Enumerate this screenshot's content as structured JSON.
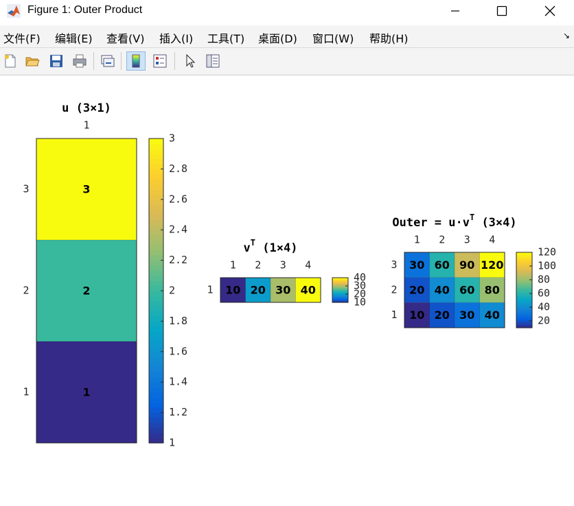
{
  "window": {
    "title": "Figure 1: Outer Product"
  },
  "menu": {
    "items": [
      "文件(F)",
      "编辑(E)",
      "查看(V)",
      "插入(I)",
      "工具(T)",
      "桌面(D)",
      "窗口(W)",
      "帮助(H)"
    ]
  },
  "toolbar": {
    "icons": [
      "new-figure-icon",
      "open-folder-icon",
      "save-icon",
      "print-icon",
      "link-plot-icon",
      "colorbar-icon",
      "legend-icon",
      "pointer-icon",
      "property-editor-icon"
    ]
  },
  "colors": {
    "parula": [
      "#352a87",
      "#0363e1",
      "#1485d4",
      "#06a7c6",
      "#38b99e",
      "#92bf73",
      "#d9ba56",
      "#fcce2e",
      "#f9fb0e"
    ]
  },
  "chart_data": [
    {
      "type": "heatmap",
      "title": "u (3×1)",
      "columns": [
        "1"
      ],
      "rows": [
        "3",
        "2",
        "1"
      ],
      "values": [
        [
          3
        ],
        [
          2
        ],
        [
          1
        ]
      ],
      "colorbar": {
        "min": 1,
        "max": 3,
        "ticks": [
          "1",
          "1.2",
          "1.4",
          "1.6",
          "1.8",
          "2",
          "2.2",
          "2.4",
          "2.6",
          "2.8",
          "3"
        ]
      }
    },
    {
      "type": "heatmap",
      "title": "v",
      "title_sup": "T",
      "title_suffix": " (1×4)",
      "columns": [
        "1",
        "2",
        "3",
        "4"
      ],
      "rows": [
        "1"
      ],
      "values": [
        [
          10,
          20,
          30,
          40
        ]
      ],
      "colorbar": {
        "min": 10,
        "max": 40,
        "ticks": [
          "10",
          "20",
          "30",
          "40"
        ]
      }
    },
    {
      "type": "heatmap",
      "title": "Outer = u·v",
      "title_sup": "T",
      "title_suffix": " (3×4)",
      "columns": [
        "1",
        "2",
        "3",
        "4"
      ],
      "rows": [
        "3",
        "2",
        "1"
      ],
      "values": [
        [
          30,
          60,
          90,
          120
        ],
        [
          20,
          40,
          60,
          80
        ],
        [
          10,
          20,
          30,
          40
        ]
      ],
      "colorbar": {
        "min": 10,
        "max": 120,
        "ticks": [
          "20",
          "40",
          "60",
          "80",
          "100",
          "120"
        ]
      }
    }
  ]
}
